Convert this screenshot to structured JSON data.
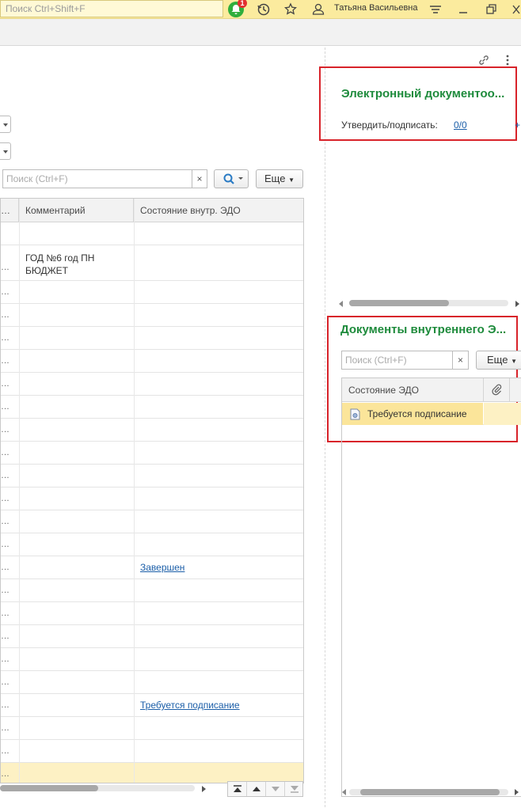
{
  "topbar": {
    "search_placeholder": "Поиск Ctrl+Shift+F",
    "notification_count": "1",
    "user_name": "Татьяна Васильевна"
  },
  "left": {
    "search_placeholder": "Поиск (Ctrl+F)",
    "clear_label": "×",
    "more_label": "Еще",
    "columns": [
      "Комментарий",
      "Состояние внутр. ЭДО"
    ],
    "rows": [
      {
        "comment": "",
        "state": ""
      },
      {
        "comment": "ГОД №6 год ПН\nБЮДЖЕТ",
        "state": ""
      },
      {
        "comment": "",
        "state": ""
      },
      {
        "comment": "",
        "state": ""
      },
      {
        "comment": "",
        "state": ""
      },
      {
        "comment": "",
        "state": ""
      },
      {
        "comment": "",
        "state": ""
      },
      {
        "comment": "",
        "state": ""
      },
      {
        "comment": "",
        "state": ""
      },
      {
        "comment": "",
        "state": ""
      },
      {
        "comment": "",
        "state": ""
      },
      {
        "comment": "",
        "state": ""
      },
      {
        "comment": "",
        "state": ""
      },
      {
        "comment": "",
        "state": ""
      },
      {
        "comment": "",
        "state": "Завершен"
      },
      {
        "comment": "",
        "state": ""
      },
      {
        "comment": "",
        "state": ""
      },
      {
        "comment": "",
        "state": ""
      },
      {
        "comment": "",
        "state": ""
      },
      {
        "comment": "",
        "state": ""
      },
      {
        "comment": "",
        "state": "Требуется подписание"
      },
      {
        "comment": "",
        "state": ""
      },
      {
        "comment": "",
        "state": ""
      },
      {
        "comment": "",
        "state": ""
      }
    ]
  },
  "edo": {
    "title": "Электронный документоо...",
    "approve_label": "Утвердить/подписать:",
    "approve_value": "0/0",
    "plus_label": "+"
  },
  "internal": {
    "title": "Документы внутреннего Э...",
    "search_placeholder": "Поиск (Ctrl+F)",
    "clear_label": "×",
    "more_label": "Еще",
    "column_state": "Состояние ЭДО",
    "row_state": "Требуется подписание"
  },
  "colors": {
    "accent_green": "#1e8b3c",
    "highlight_red": "#d8232a",
    "link_blue": "#1b5ea8",
    "topbar_yellow": "#fbeb9e"
  },
  "icons": [
    "bell-icon",
    "history-icon",
    "star-icon",
    "user-icon",
    "menu-icon",
    "restore-icon",
    "link-icon",
    "more-vertical-icon",
    "search-icon",
    "attachment-icon",
    "document-icon"
  ]
}
